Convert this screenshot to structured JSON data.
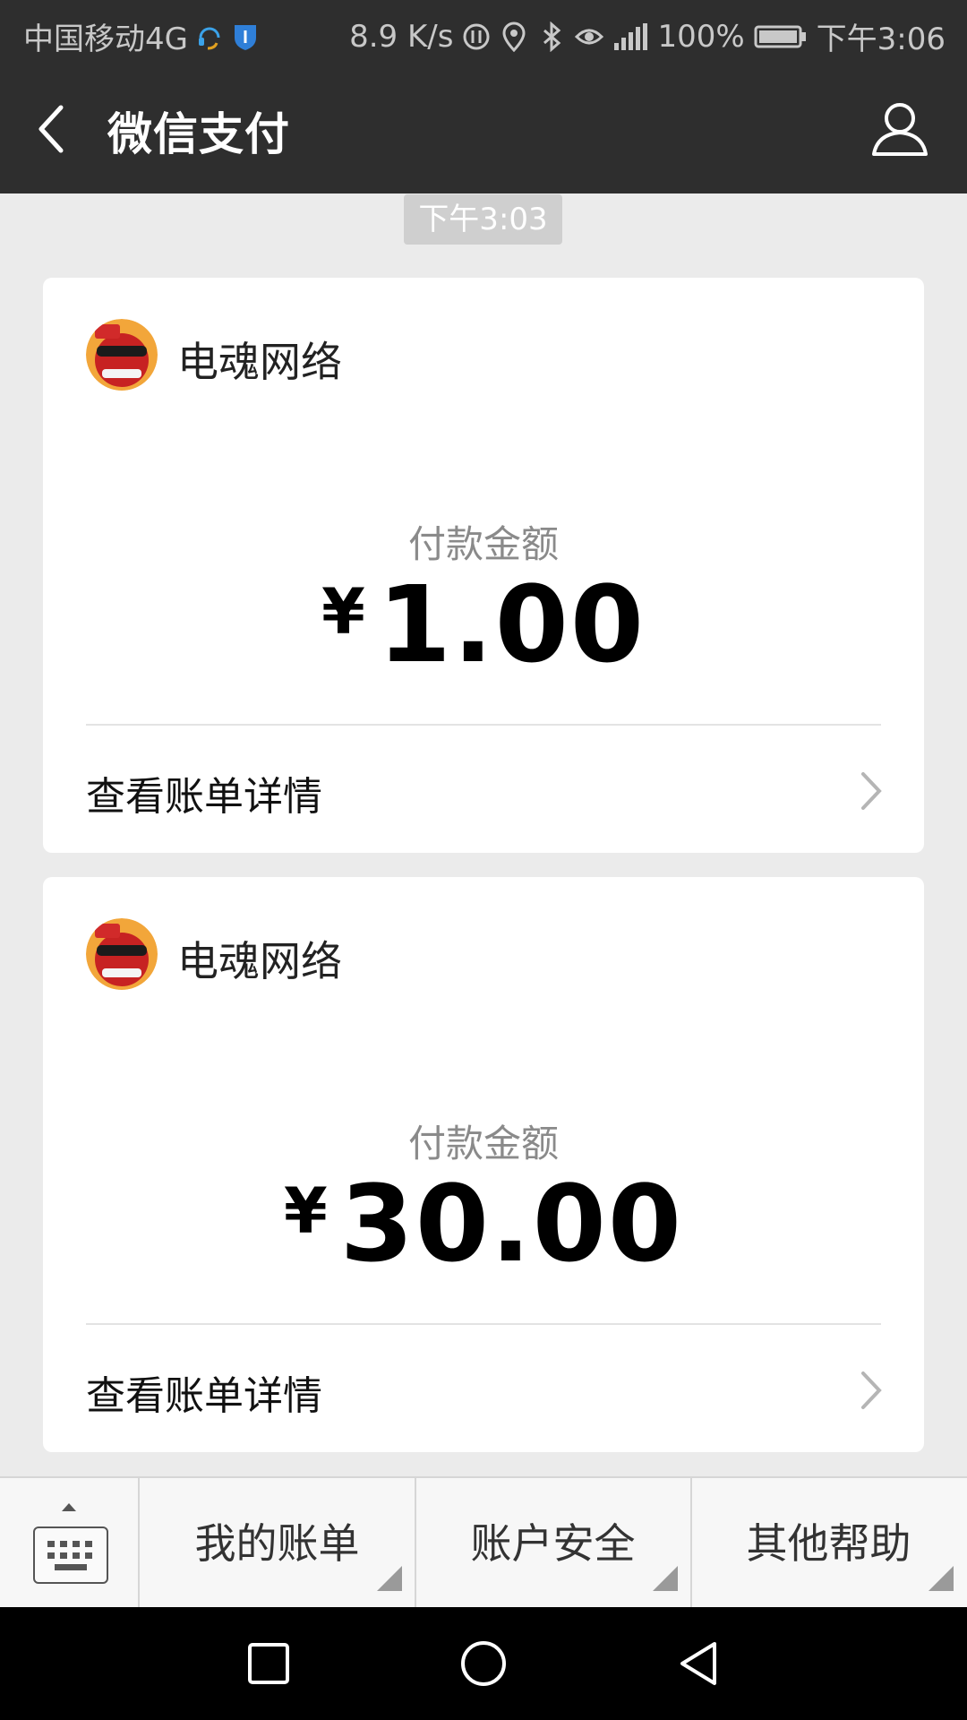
{
  "status_bar": {
    "carrier": "中国移动4G",
    "speed": "8.9 K/s",
    "battery": "100%",
    "time": "下午3:06"
  },
  "header": {
    "title": "微信支付"
  },
  "timestamp": "下午3:03",
  "cards": [
    {
      "merchant": "电魂网络",
      "amount_label": "付款金额",
      "currency": "¥",
      "amount": "1.00",
      "detail_label": "查看账单详情"
    },
    {
      "merchant": "电魂网络",
      "amount_label": "付款金额",
      "currency": "¥",
      "amount": "30.00",
      "detail_label": "查看账单详情"
    }
  ],
  "menu": {
    "items": [
      "我的账单",
      "账户安全",
      "其他帮助"
    ]
  },
  "colors": {
    "header_bg": "#2e2e2e",
    "page_bg": "#ebebeb",
    "card_bg": "#ffffff"
  }
}
